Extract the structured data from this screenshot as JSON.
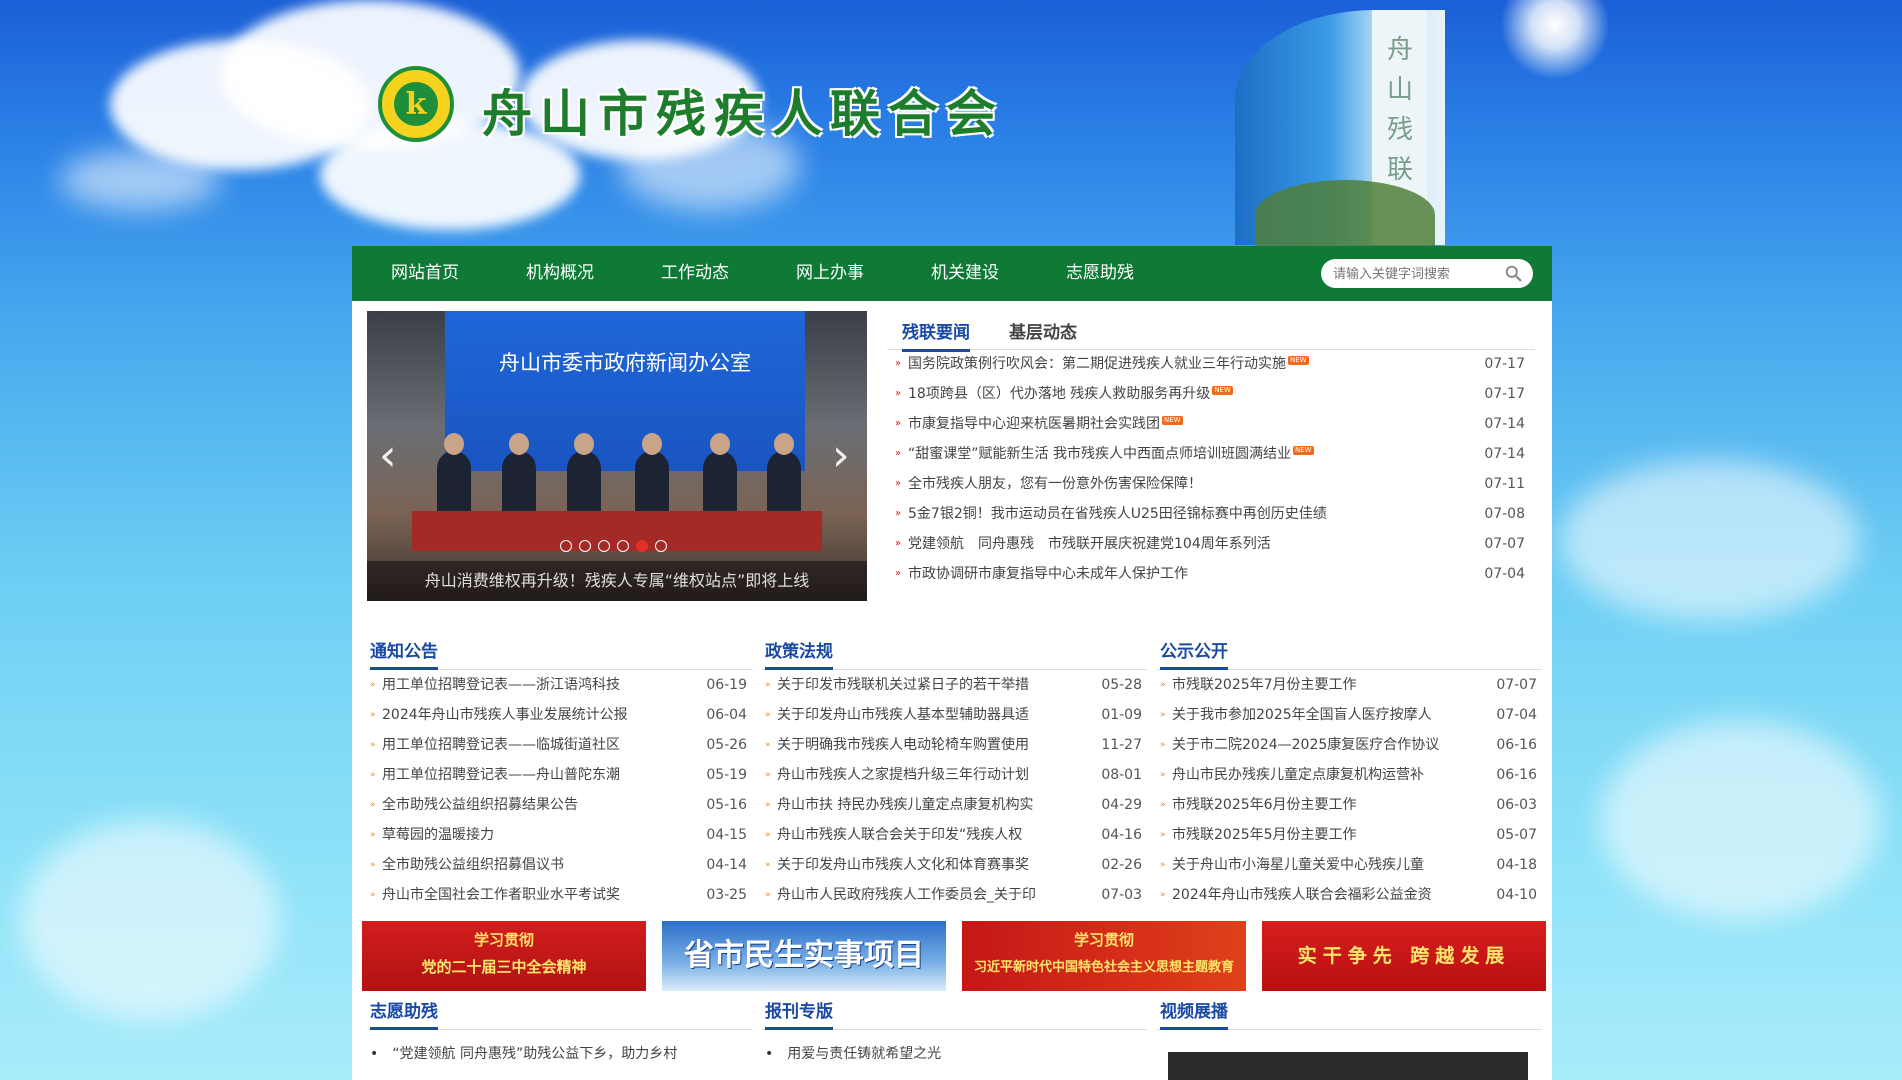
{
  "header": {
    "site_title": "舟山市残疾人联合会",
    "logo_glyph": "k",
    "building_sign": "舟山残联"
  },
  "nav": {
    "items": [
      {
        "label": "网站首页"
      },
      {
        "label": "机构概况"
      },
      {
        "label": "工作动态"
      },
      {
        "label": "网上办事"
      },
      {
        "label": "机关建设"
      },
      {
        "label": "志愿助残"
      }
    ],
    "search_placeholder": "请输入关键字词搜索"
  },
  "slider": {
    "screen_text": "舟山市委市政府新闻办公室",
    "caption": "舟山消费维权再升级！残疾人专属“维权站点”即将上线",
    "prev": "‹",
    "next": "›",
    "slide_count": 6,
    "active_index": 4
  },
  "news": {
    "tabs": [
      {
        "label": "残联要闻",
        "active": true
      },
      {
        "label": "基层动态",
        "active": false
      }
    ],
    "badge": "NEW",
    "items": [
      {
        "title": "国务院政策例行吹风会：第二期促进残疾人就业三年行动实施",
        "date": "07-17",
        "is_new": true
      },
      {
        "title": "18项跨县（区）代办落地 残疾人救助服务再升级",
        "date": "07-17",
        "is_new": true
      },
      {
        "title": "市康复指导中心迎来杭医暑期社会实践团",
        "date": "07-14",
        "is_new": true
      },
      {
        "title": "“甜蜜课堂”赋能新生活 我市残疾人中西面点师培训班圆满结业",
        "date": "07-14",
        "is_new": true
      },
      {
        "title": "全市残疾人朋友，您有一份意外伤害保险保障！",
        "date": "07-11",
        "is_new": false
      },
      {
        "title": "5金7银2铜！我市运动员在省残疾人U25田径锦标赛中再创历史佳绩",
        "date": "07-08",
        "is_new": false
      },
      {
        "title": "党建领航　同舟惠残　市残联开展庆祝建党104周年系列活",
        "date": "07-07",
        "is_new": false
      },
      {
        "title": "市政协调研市康复指导中心未成年人保护工作",
        "date": "07-04",
        "is_new": false
      }
    ]
  },
  "notices": {
    "title": "通知公告",
    "items": [
      {
        "title": "用工单位招聘登记表——浙江语鸿科技",
        "date": "06-19"
      },
      {
        "title": "2024年舟山市残疾人事业发展统计公报",
        "date": "06-04"
      },
      {
        "title": "用工单位招聘登记表——临城街道社区",
        "date": "05-26"
      },
      {
        "title": "用工单位招聘登记表——舟山普陀东潮",
        "date": "05-19"
      },
      {
        "title": "全市助残公益组织招募结果公告",
        "date": "05-16"
      },
      {
        "title": "草莓园的温暖接力",
        "date": "04-15"
      },
      {
        "title": "全市助残公益组织招募倡议书",
        "date": "04-14"
      },
      {
        "title": "舟山市全国社会工作者职业水平考试奖",
        "date": "03-25"
      }
    ]
  },
  "policies": {
    "title": "政策法规",
    "items": [
      {
        "title": "关于印发市残联机关过紧日子的若干举措",
        "date": "05-28"
      },
      {
        "title": "关于印发舟山市残疾人基本型辅助器具适",
        "date": "01-09"
      },
      {
        "title": "关于明确我市残疾人电动轮椅车购置使用",
        "date": "11-27"
      },
      {
        "title": "舟山市残疾人之家提档升级三年行动计划",
        "date": "08-01"
      },
      {
        "title": "舟山市扶 持民办残疾儿童定点康复机构实",
        "date": "04-29"
      },
      {
        "title": "舟山市残疾人联合会关于印发“残疾人权",
        "date": "04-16"
      },
      {
        "title": "关于印发舟山市残疾人文化和体育赛事奖",
        "date": "02-26"
      },
      {
        "title": "舟山市人民政府残疾人工作委员会_关于印",
        "date": "07-03"
      }
    ]
  },
  "disclosure": {
    "title": "公示公开",
    "items": [
      {
        "title": "市残联2025年7月份主要工作",
        "date": "07-07"
      },
      {
        "title": "关于我市参加2025年全国盲人医疗按摩人",
        "date": "07-04"
      },
      {
        "title": "关于市二院2024—2025康复医疗合作协议",
        "date": "06-16"
      },
      {
        "title": "舟山市民办残疾儿童定点康复机构运营补",
        "date": "06-16"
      },
      {
        "title": "市残联2025年6月份主要工作",
        "date": "06-03"
      },
      {
        "title": "市残联2025年5月份主要工作",
        "date": "05-07"
      },
      {
        "title": "关于舟山市小海星儿童关爱中心残疾儿童",
        "date": "04-18"
      },
      {
        "title": "2024年舟山市残疾人联合会福彩公益金资",
        "date": "04-10"
      }
    ]
  },
  "banners": [
    {
      "line1": "学习贯彻",
      "line2": "党的二十届三中全会精神"
    },
    {
      "big": "省市民生实事项目"
    },
    {
      "line1": "学习贯彻",
      "line2": "习近平新时代中国特色社会主义思想主题教育"
    },
    {
      "slogan": "实干争先  跨越发展"
    }
  ],
  "bottom": {
    "volunteer": {
      "title": "志愿助残",
      "first_item": "“党建领航 同舟惠残”助残公益下乡，助力乡村",
      "bullet": "•"
    },
    "newspaper": {
      "title": "报刊专版",
      "first_item": "用爱与责任铸就希望之光",
      "bullet": "•"
    },
    "video": {
      "title": "视频展播"
    }
  },
  "marks": {
    "news_marker": "»",
    "list_marker": "»"
  }
}
